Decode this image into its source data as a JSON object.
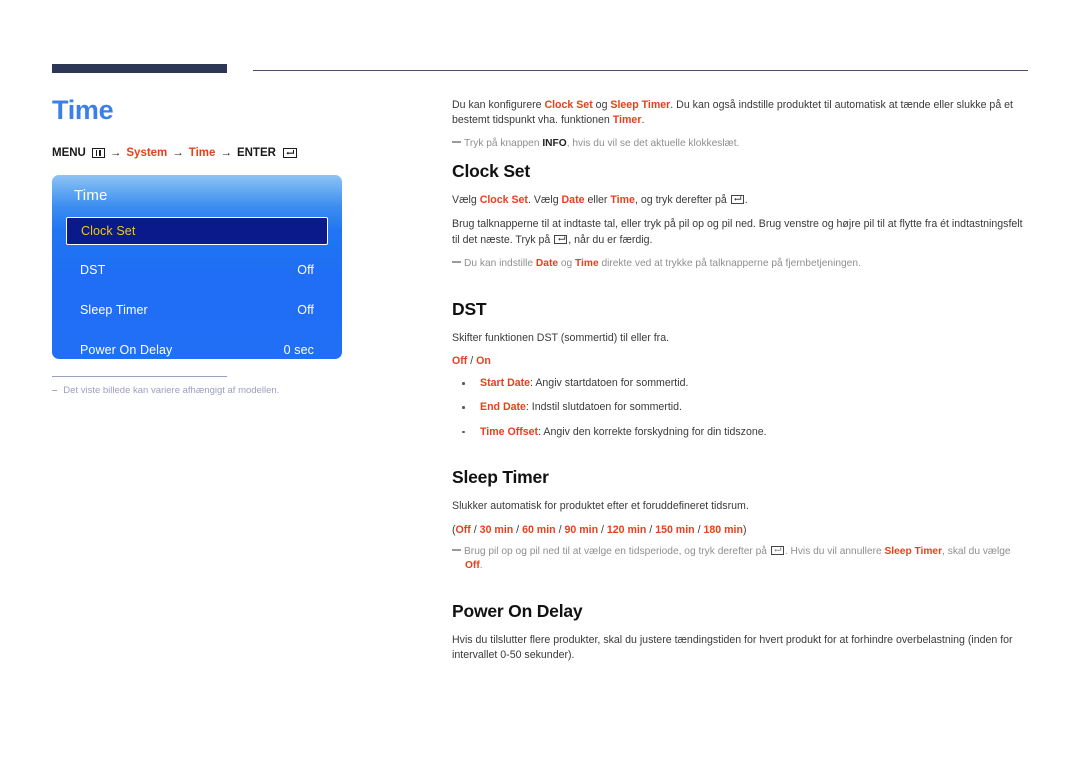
{
  "header": {
    "bar_color": "#2c3756",
    "rule_color": "#4b4f6b"
  },
  "left": {
    "page_title": "Time",
    "title_color": "#3d7fe8",
    "breadcrumb": {
      "menu_label": "MENU",
      "menu_icon": "menu-grid-icon",
      "arrow1": "→",
      "item1": "System",
      "arrow2": "→",
      "item2": "Time",
      "arrow3": "→",
      "enter_label": "ENTER",
      "enter_icon": "enter-key-icon"
    },
    "osd": {
      "title": "Time",
      "rows": [
        {
          "label": "Clock Set",
          "value": "",
          "selected": true
        },
        {
          "label": "DST",
          "value": "Off",
          "selected": false
        },
        {
          "label": "Sleep Timer",
          "value": "Off",
          "selected": false
        },
        {
          "label": "Power On Delay",
          "value": "0 sec",
          "selected": false
        }
      ],
      "highlight_bg": "#0b1a8a",
      "highlight_text": "#f5c518",
      "panel_blue": "#1f6ef5"
    },
    "caption": {
      "dash": "–",
      "text": "Det viste billede kan variere afhængigt af modellen."
    }
  },
  "right": {
    "intro": {
      "p1_a": "Du kan konfigurere ",
      "p1_b": "Clock Set",
      "p1_c": " og ",
      "p1_d": "Sleep Timer",
      "p1_e": ". Du kan også indstille produktet til automatisk at tænde eller slukke på et bestemt tidspunkt vha. funktionen ",
      "p1_f": "Timer",
      "p1_g": ".",
      "note_a": "Tryk på knappen ",
      "note_b": "INFO",
      "note_c": ", hvis du vil se det aktuelle klokkeslæt."
    },
    "clock_set": {
      "heading": "Clock Set",
      "p1_a": "Vælg ",
      "p1_b": "Clock Set",
      "p1_c": ". Vælg ",
      "p1_d": "Date",
      "p1_e": " eller ",
      "p1_f": "Time",
      "p1_g": ", og tryk derefter på ",
      "p1_h": ".",
      "p2_a": "Brug talknapperne til at indtaste tal, eller tryk på pil op og pil ned. Brug venstre og højre pil til at flytte fra ét indtastningsfelt til det næste. Tryk på ",
      "p2_b": ", når du er færdig.",
      "note_a": "Du kan indstille ",
      "note_b": "Date",
      "note_c": " og ",
      "note_d": "Time",
      "note_e": " direkte ved at trykke på talknapperne på fjernbetjeningen."
    },
    "dst": {
      "heading": "DST",
      "p1": "Skifter funktionen DST (sommertid) til eller fra.",
      "options_off": "Off",
      "options_sep": " / ",
      "options_on": "On",
      "bullets": [
        {
          "term": "Start Date",
          "desc": ": Angiv startdatoen for sommertid."
        },
        {
          "term": "End Date",
          "desc": ": Indstil slutdatoen for sommertid."
        },
        {
          "term": "Time Offset",
          "desc": ": Angiv den korrekte forskydning for din tidszone."
        }
      ]
    },
    "sleep_timer": {
      "heading": "Sleep Timer",
      "p1": "Slukker automatisk for produktet efter et foruddefineret tidsrum.",
      "options_open": "(",
      "options": [
        "Off",
        "30 min",
        "60 min",
        "90 min",
        "120 min",
        "150 min",
        "180 min"
      ],
      "options_close": ")",
      "note_a": "Brug pil op og pil ned til at vælge en tidsperiode, og tryk derefter på ",
      "note_b": ". Hvis du vil annullere ",
      "note_c": "Sleep Timer",
      "note_d": ", skal du vælge",
      "note_e": "Off",
      "note_f": "."
    },
    "power_on_delay": {
      "heading": "Power On Delay",
      "p1": "Hvis du tilslutter flere produkter, skal du justere tændingstiden for hvert produkt for at forhindre overbelastning (inden for intervallet 0-50 sekunder)."
    }
  }
}
